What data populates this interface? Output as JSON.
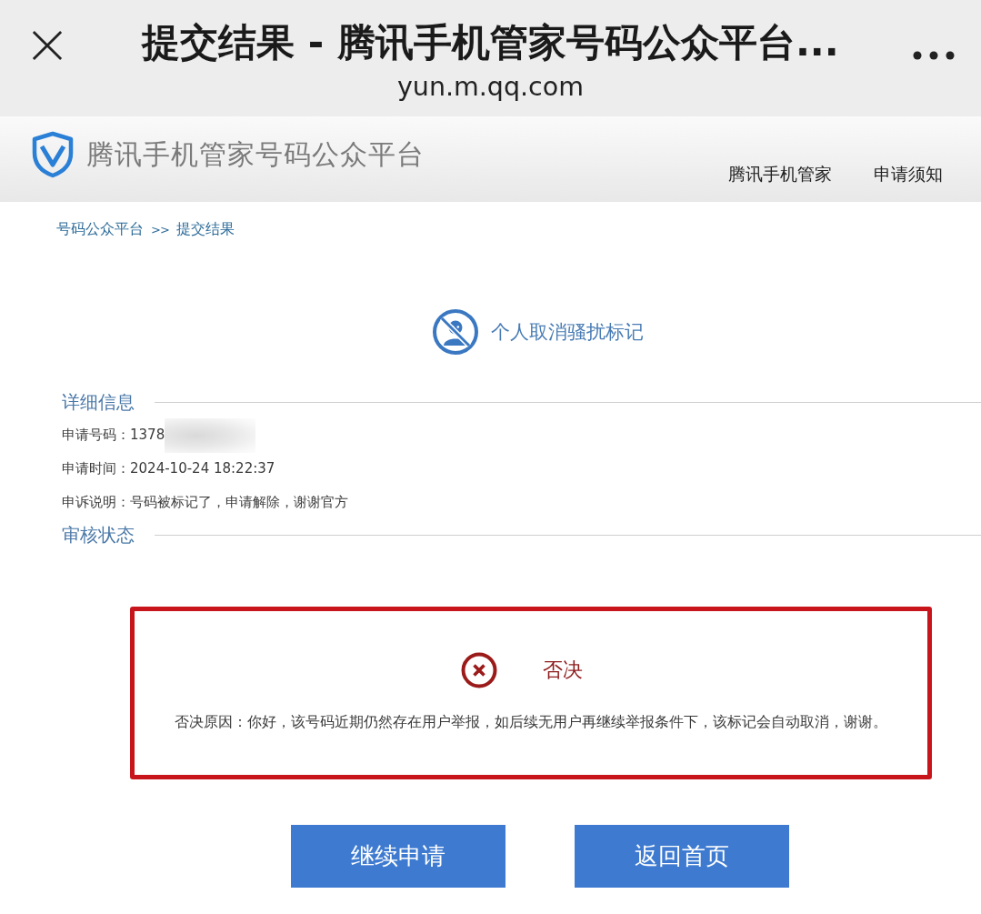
{
  "browser_bar": {
    "title": "提交结果 - 腾讯手机管家号码公众平台...",
    "url": "yun.m.qq.com"
  },
  "site_header": {
    "logo_text": "腾讯手机管家号码公众平台",
    "nav": [
      {
        "label": "腾讯手机管家"
      },
      {
        "label": "申请须知"
      }
    ]
  },
  "breadcrumb": {
    "items": [
      {
        "label": "号码公众平台"
      },
      {
        "label": "提交结果"
      }
    ],
    "separator": ">>"
  },
  "request_type": {
    "label": "个人取消骚扰标记"
  },
  "details": {
    "heading": "详细信息",
    "fields": [
      {
        "label": "申请号码：",
        "value": "1378",
        "redacted": true
      },
      {
        "label": "申请时间：",
        "value": "2024-10-24 18:22:37",
        "redacted": false
      },
      {
        "label": "申诉说明：",
        "value": "号码被标记了，申请解除，谢谢官方",
        "redacted": false
      }
    ]
  },
  "review": {
    "heading": "审核状态",
    "status": {
      "kind": "rejected",
      "label": "否决"
    },
    "reason": "否决原因：你好，该号码近期仍然存在用户举报，如后续无用户再继续举报条件下，该标记会自动取消，谢谢。",
    "highlighted": true
  },
  "buttons": [
    {
      "label": "继续申请"
    },
    {
      "label": "返回首页"
    }
  ]
}
